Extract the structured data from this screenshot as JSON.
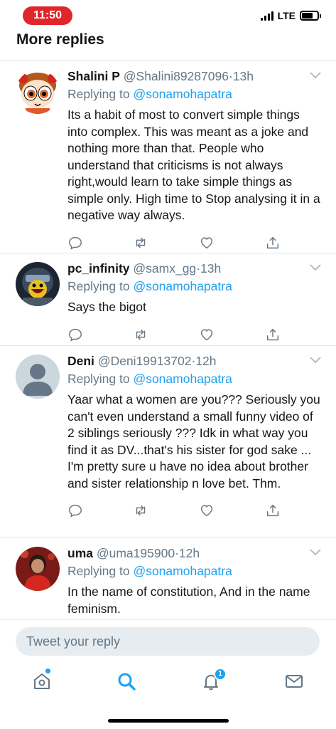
{
  "status_bar": {
    "time": "11:50",
    "network": "LTE",
    "time_pill_color": "#e0262b"
  },
  "section": {
    "title": "More replies"
  },
  "colors": {
    "link": "#1da1f2",
    "muted": "#657786",
    "text": "#14171a",
    "divider": "#e1e8ed"
  },
  "tweets": [
    {
      "name": "Shalini P",
      "handle": "@Shalini89287096",
      "separator": "·",
      "time": "13h",
      "replying_prefix": "Replying to",
      "replying_to": "@sonamohapatra",
      "text": "Its a habit of most to convert simple things into complex. This was meant as a joke and nothing more than that. People who understand that criticisms is not always right,would learn to take  simple things as simple only. High time to Stop analysing it in a negative way always.",
      "avatar_icon": "powerpuff-girl-avatar"
    },
    {
      "name": "pc_infinity",
      "handle": "@samx_gg",
      "separator": "·",
      "time": "13h",
      "replying_prefix": "Replying to",
      "replying_to": "@sonamohapatra",
      "text": "Says the bigot",
      "avatar_icon": "gamer-character-avatar"
    },
    {
      "name": "Deni",
      "handle": "@Deni19913702",
      "separator": "·",
      "time": "12h",
      "replying_prefix": "Replying to",
      "replying_to": "@sonamohapatra",
      "text": "Yaar what a women are you??? Seriously you can't even understand  a small funny video  of 2 siblings  seriously ??? Idk in what way you find it as DV...that's his sister for god sake ... I'm pretty  sure  u have no idea about brother and sister relationship n love bet. Thm.",
      "avatar_icon": "default-profile-avatar"
    },
    {
      "name": "uma",
      "handle": "@uma195900",
      "separator": "·",
      "time": "12h",
      "replying_prefix": "Replying to",
      "replying_to": "@sonamohapatra",
      "text": "In the name of constitution, And in the name feminism.",
      "avatar_icon": "person-photo-avatar"
    }
  ],
  "reply_bar": {
    "placeholder": "Tweet your reply"
  },
  "tab_bar": {
    "notifications_badge": "1",
    "icons": [
      "home-icon",
      "search-icon",
      "notifications-icon",
      "messages-icon"
    ]
  }
}
